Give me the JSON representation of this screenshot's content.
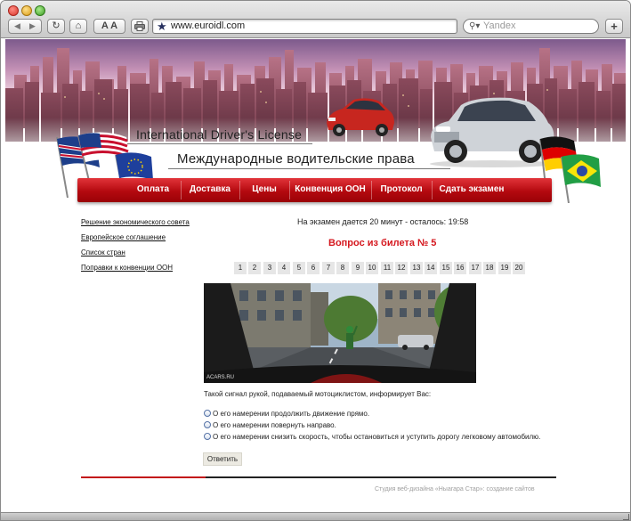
{
  "browser": {
    "url": "www.euroidl.com",
    "search_placeholder": "Yandex",
    "font_buttons": "A A",
    "add_button": "+"
  },
  "header": {
    "title_en": "International Driver's License",
    "title_ru": "Международные водительские права"
  },
  "menu": {
    "items": [
      "Оплата",
      "Доставка",
      "Цены",
      "Конвенция ООН",
      "Протокол",
      "Сдать экзамен"
    ]
  },
  "sidebar": {
    "links": [
      "Решение экономического совета",
      "Европейское соглашение",
      "Список стран",
      "Поправки к конвенции ООН"
    ]
  },
  "exam": {
    "timer": "На экзамен дается 20 минут - осталось: 19:58",
    "question_title": "Вопрос из билета № 5",
    "tickets": [
      "1",
      "2",
      "3",
      "4",
      "5",
      "6",
      "7",
      "8",
      "9",
      "10",
      "11",
      "12",
      "13",
      "14",
      "15",
      "16",
      "17",
      "18",
      "19",
      "20"
    ],
    "image_watermark": "ACARS.RU",
    "question": "Такой сигнал рукой, подаваемый мотоциклистом, информирует Вас:",
    "answers": [
      "О его намерении продолжить движение прямо.",
      "О его намерении повернуть направо.",
      "О его намерении снизить скорость, чтобы остановиться и уступить дорогу легковому автомобилю."
    ],
    "submit_label": "Ответить"
  },
  "footer": {
    "text": "Студия веб-дизайна «Ныагара Стар»: создание сайтов"
  },
  "colors": {
    "accent_red": "#c3141a",
    "question_red": "#d5181f",
    "menu_red": "#b4090f"
  }
}
